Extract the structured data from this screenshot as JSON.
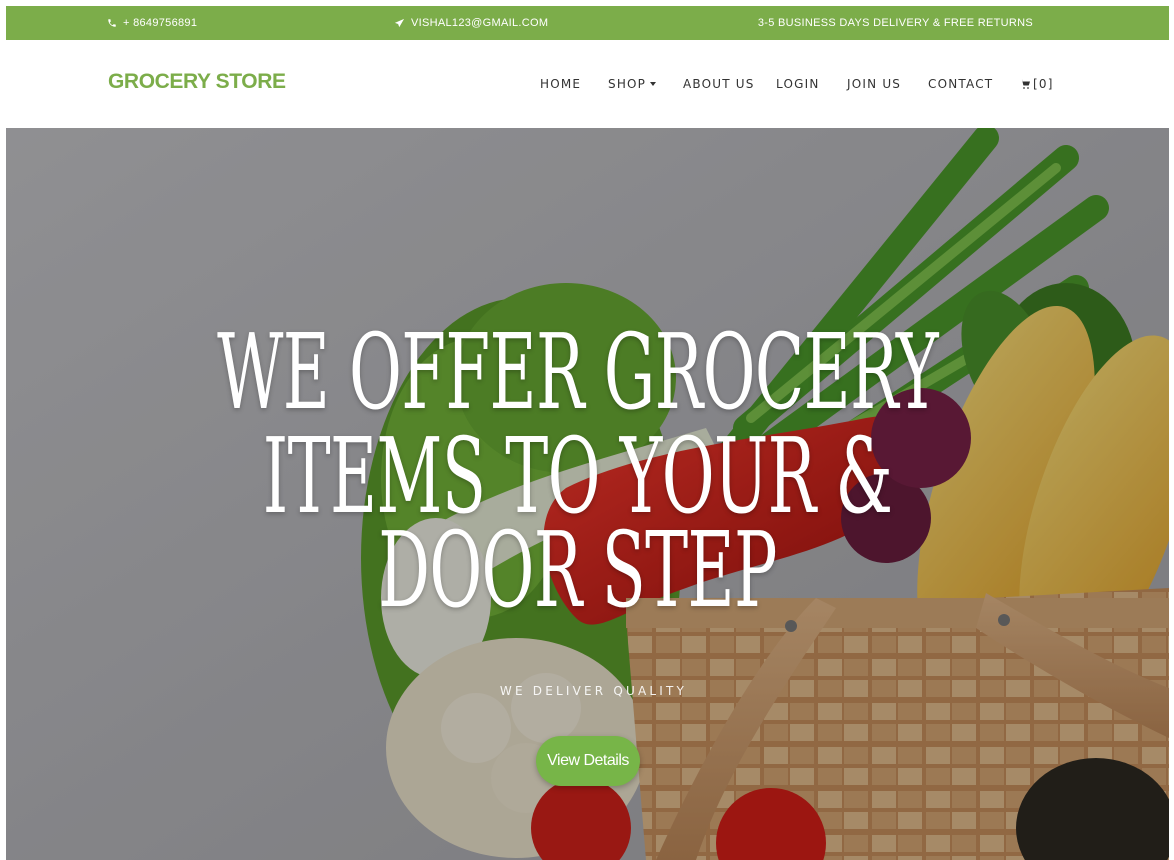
{
  "topbar": {
    "phone": "+ 8649756891",
    "email": "VISHAL123@GMAIL.COM",
    "delivery": "3-5 BUSINESS DAYS DELIVERY & FREE RETURNS",
    "phone_icon": "phone-icon",
    "email_icon": "paper-plane-icon",
    "background_color": "#7cad4a"
  },
  "header": {
    "brand": "GROCERY STORE",
    "brand_color": "#7cad4a"
  },
  "nav": {
    "home": "HOME",
    "shop": "SHOP",
    "about": "ABOUT US",
    "login": "LOGIN",
    "join": "JOIN US",
    "contact": "CONTACT",
    "cart_count": "[0]",
    "cart_icon": "cart-icon"
  },
  "hero": {
    "title_line1": "We offer Grocery Items to your &",
    "title_line2": "Door Step",
    "subtitle": "WE DELIVER QUALITY",
    "cta": "View Details",
    "cta_color": "#77b548"
  }
}
